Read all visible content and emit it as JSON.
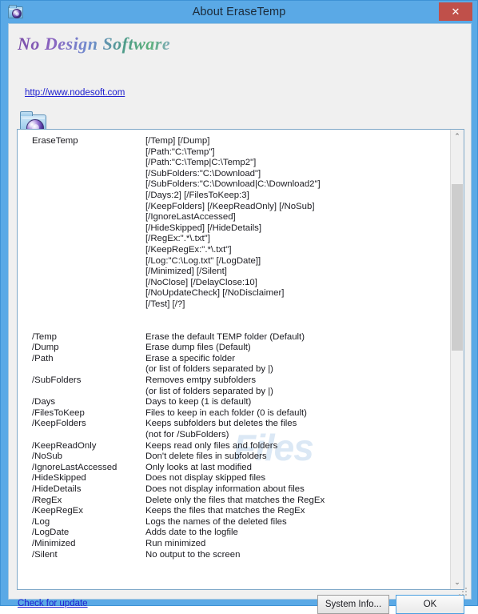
{
  "window": {
    "title": "About EraseTemp",
    "icon": "folder-swirl-icon",
    "close_label": "✕",
    "accent_color": "#5aa9e6",
    "close_color": "#c0504a"
  },
  "brand": {
    "logo_text": "No Design Software",
    "url": "http://www.nodesoft.com",
    "url_color": "#2020d0",
    "app_icon": "folder-swirl-icon"
  },
  "watermark": {
    "text": "Files"
  },
  "help": {
    "syntax": {
      "program": "EraseTemp",
      "lines": [
        "[/Temp] [/Dump]",
        "[/Path:\"C:\\Temp\"]",
        "[/Path:\"C:\\Temp|C:\\Temp2\"]",
        "[/SubFolders:\"C:\\Download\"]",
        "[/SubFolders:\"C:\\Download|C:\\Download2\"]",
        "[/Days:2] [/FilesToKeep:3]",
        "[/KeepFolders] [/KeepReadOnly] [/NoSub]",
        "[/IgnoreLastAccessed]",
        "[/HideSkipped] [/HideDetails]",
        "[/RegEx:\".*\\.txt\"]",
        "[/KeepRegEx:\".*\\.txt\"]",
        "[/Log:\"C:\\Log.txt\" [/LogDate]]",
        "[/Minimized] [/Silent]",
        "[/NoClose] [/DelayClose:10]",
        "[/NoUpdateCheck] [/NoDisclaimer]",
        "[/Test] [/?]"
      ]
    },
    "options": [
      {
        "switch": "/Temp",
        "description": "Erase the default TEMP folder (Default)"
      },
      {
        "switch": "/Dump",
        "description": "Erase dump files (Default)"
      },
      {
        "switch": "/Path",
        "description": "Erase a specific folder"
      },
      {
        "switch": "",
        "description": "(or list of folders separated by |)"
      },
      {
        "switch": "/SubFolders",
        "description": "Removes emtpy subfolders"
      },
      {
        "switch": "",
        "description": "(or list of folders separated by |)"
      },
      {
        "switch": "/Days",
        "description": "Days to keep (1 is default)"
      },
      {
        "switch": "/FilesToKeep",
        "description": "Files to keep in each folder (0 is default)"
      },
      {
        "switch": "/KeepFolders",
        "description": "Keeps subfolders but deletes the files"
      },
      {
        "switch": "",
        "description": "(not for /SubFolders)"
      },
      {
        "switch": "/KeepReadOnly",
        "description": "Keeps read only files and folders"
      },
      {
        "switch": "/NoSub",
        "description": "Don't delete files in subfolders"
      },
      {
        "switch": "/IgnoreLastAccessed",
        "description": "Only looks at last modified"
      },
      {
        "switch": "/HideSkipped",
        "description": "Does not display skipped files"
      },
      {
        "switch": "/HideDetails",
        "description": "Does not display information about files"
      },
      {
        "switch": "/RegEx",
        "description": "Delete only the files that matches the RegEx"
      },
      {
        "switch": "/KeepRegEx",
        "description": "Keeps the files that matches the RegEx"
      },
      {
        "switch": "/Log",
        "description": "Logs the names of the deleted files"
      },
      {
        "switch": "/LogDate",
        "description": "Adds date to the logfile"
      },
      {
        "switch": "/Minimized",
        "description": "Run minimized"
      },
      {
        "switch": "/Silent",
        "description": "No output to the screen"
      }
    ]
  },
  "scrollbar": {
    "up_arrow": "⌃",
    "down_arrow": "⌄"
  },
  "footer": {
    "check_update_label": "Check for update",
    "system_info_label": "System Info...",
    "ok_label": "OK"
  }
}
